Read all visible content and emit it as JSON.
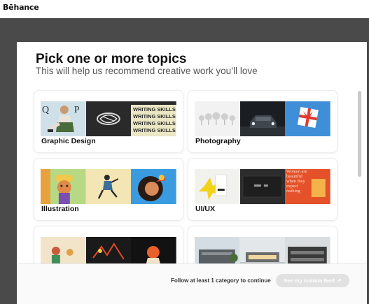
{
  "app": {
    "logo": "Bēhance"
  },
  "modal": {
    "title": "Pick one or more topics",
    "subtitle": "This will help us recommend creative work you’ll love"
  },
  "topics": [
    {
      "label": "Graphic Design",
      "thumbs": [
        "fashion-photo",
        "lettering-dark",
        "writing-skills-type"
      ]
    },
    {
      "label": "Photography",
      "thumbs": [
        "trees-white",
        "car-night",
        "gift-blue"
      ]
    },
    {
      "label": "Illustration",
      "thumbs": [
        "character-green",
        "runner-yellow",
        "girl-blue"
      ]
    },
    {
      "label": "UI/UX",
      "thumbs": [
        "yellow-flower-ui",
        "dark-dashboard",
        "orange-typography"
      ]
    },
    {
      "label": "",
      "thumbs": [
        "kids-cream",
        "dark-scene",
        "dancer-dark"
      ]
    },
    {
      "label": "",
      "thumbs": [
        "building-sky",
        "house-dusk",
        "modern-building"
      ]
    }
  ],
  "thumb_text": {
    "writing_skills": "WRITING SKILLS",
    "typography_sample": "Women are beautiful when they expect nothing"
  },
  "footer": {
    "hint": "Follow at least 1 category to continue",
    "cta_label": "See my custom feed",
    "cta_icon": "arrow-right-icon"
  },
  "colors": {
    "backdrop": "#4a4a4a",
    "cta_disabled": "#e1e1e1",
    "title": "#111111",
    "subtitle": "#555555"
  }
}
